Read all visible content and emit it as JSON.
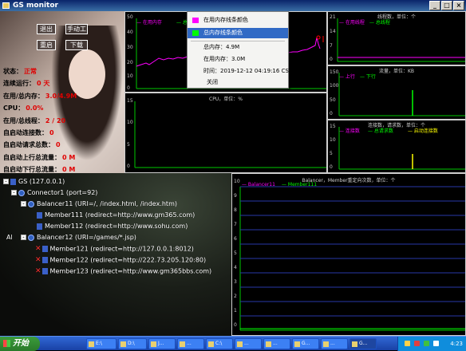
{
  "window": {
    "title": "GS monitor"
  },
  "toolbar": {
    "buttons": [
      "退出",
      "手动工",
      "重启",
      "下载"
    ]
  },
  "stats": [
    {
      "label": "状态：",
      "value": "正常"
    },
    {
      "label": "连续运行：",
      "value": "0 天"
    },
    {
      "label": "在用/总内存：",
      "value": "3.0/4.9M"
    },
    {
      "label": "CPU：",
      "value": "0.0%"
    },
    {
      "label": "在用/总线程：",
      "value": "2 / 20"
    },
    {
      "label": "自启动连接数：",
      "value": "0"
    },
    {
      "label": "自启动请求总数：",
      "value": "0"
    },
    {
      "label": "自启动上行总流量：",
      "value": "0 M"
    },
    {
      "label": "自启动下行总流量：",
      "value": "0 M"
    }
  ],
  "charts": {
    "memory": {
      "legend": [
        "— 在用内存",
        "— 总内存"
      ],
      "yticks": [
        "50",
        "40",
        "30",
        "20",
        "10",
        "0"
      ],
      "colors": [
        "#ff00ff",
        "#00ff00"
      ]
    },
    "cpu": {
      "title": "CPU，单位：%",
      "yticks": [
        "15",
        "10",
        "5",
        "0"
      ]
    },
    "threads": {
      "title": "线程数，单位：个",
      "legend": [
        "— 在用线程",
        "— 总线程"
      ],
      "yticks": [
        "21",
        "14",
        "7",
        "0"
      ]
    },
    "traffic": {
      "title": "流量，单位：KB",
      "legend": [
        "— 上行",
        "— 下行"
      ],
      "yticks": [
        "150",
        "100",
        "50",
        "0"
      ]
    },
    "connections": {
      "title": "连接数，请求数，单位：个",
      "legend": [
        "— 连接数",
        "— 总请求数",
        "— 启动连接数"
      ],
      "yticks": [
        "15",
        "10",
        "5",
        "0"
      ]
    },
    "balancer": {
      "title": "Balancer，Member重定向次数，单位：个",
      "legend": [
        "— Balancer11",
        "— Member111"
      ],
      "yticks": [
        "10",
        "9",
        "8",
        "7",
        "6",
        "5",
        "4",
        "3",
        "2",
        "1",
        "0"
      ]
    }
  },
  "popup": {
    "items": [
      "在用内存线条颜色",
      "总内存线条颜色"
    ],
    "info": [
      "总内存：4.9M",
      "在用内存：3.0M",
      "时间：2019-12-12 04:19:16 CST"
    ],
    "close": "关闭"
  },
  "tree": {
    "gs": "GS (127.0.0.1)",
    "connector": "Connector1 (port=92)",
    "balancer11": "Balancer11 (URI=/, /index.html, /index.htm)",
    "member111": "Member111 (redirect=http://www.gm365.com)",
    "member112": "Member112 (redirect=http://www.sohu.com)",
    "balancer12": "Balancer12 (URI=/games/*.jsp)",
    "member121": "Member121 (redirect=http://127.0.0.1:8012)",
    "member122": "Member122 (redirect=http://222.73.205.120:80)",
    "member123": "Member123 (redirect=http://www.gm365bbs.com)",
    "al": "Al"
  },
  "taskbar": {
    "start": "开始",
    "items": [
      "E:\\",
      "D:\\",
      "J...",
      "...",
      "C:\\",
      "...",
      "...",
      "G...",
      "...",
      "G..."
    ],
    "clock": "4:23"
  }
}
